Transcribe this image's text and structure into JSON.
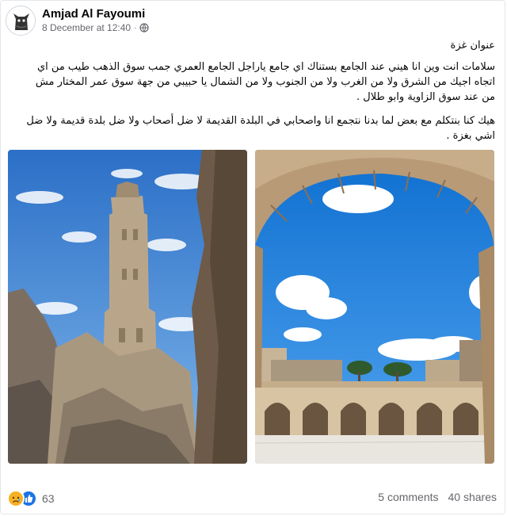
{
  "post": {
    "author": "Amjad Al Fayoumi",
    "timestamp": "8 December at 12:40",
    "privacy_icon": "globe-icon",
    "text_lines": {
      "title": "عنوان غزة",
      "para1": "سلامات انت وين انا هيني عند الجامع بستناك اي جامع ياراجل الجامع العمري جمب سوق الذهب طيب من اي اتجاه اجيك من الشرق ولا من الغرب ولا من الجنوب ولا من الشمال يا حبيبي من جهة سوق عمر المختار مش من عند سوق الزاوية وابو طلال .",
      "para2": "هيك كنا بنتكلم مع بعض لما بدنا نتجمع انا واصحابي في البلدة القديمة لا ضل أصحاب ولا ضل بلدة قديمة ولا ضل اشي بغزة ."
    }
  },
  "footer": {
    "reaction_icons": [
      "sad-reaction-icon",
      "like-reaction-icon"
    ],
    "reaction_count": "63",
    "comments": "5 comments",
    "shares": "40 shares"
  },
  "colors": {
    "sky": "#2f86dc",
    "link_gray": "#65676b",
    "like_blue": "#1b74e4",
    "sad_yellow": "#f7b125"
  }
}
